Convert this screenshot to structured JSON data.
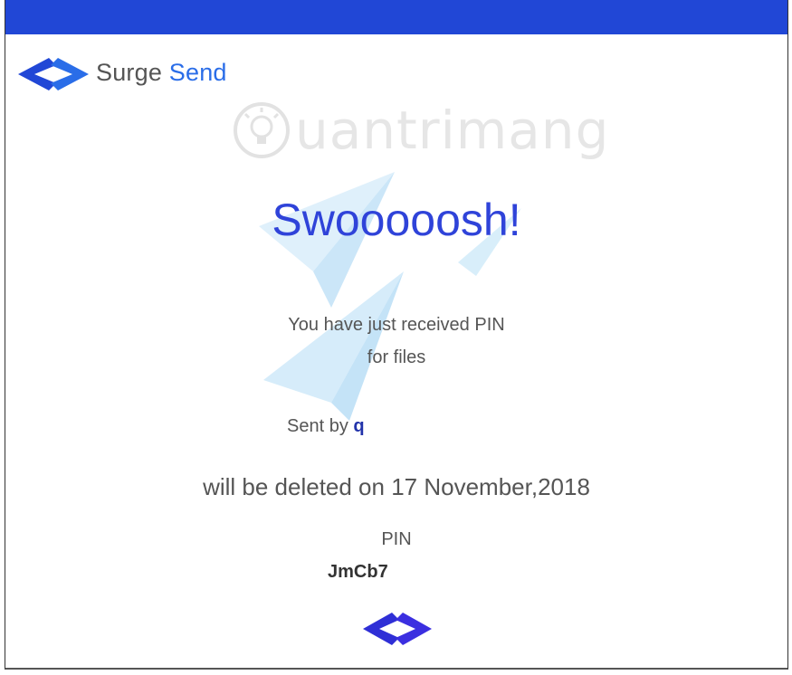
{
  "colors": {
    "topbar": "#2147d6",
    "brand_blue": "#2f43d9",
    "text_gray": "#555555"
  },
  "logo": {
    "word1": "Surge",
    "word2": "Send",
    "icon": "surge-send-arrows-icon"
  },
  "watermark": {
    "text": "uantrimang",
    "icon": "lightbulb-icon"
  },
  "headline": "Swooooosh!",
  "message": {
    "line1": "You have just received PIN",
    "line2": "for files"
  },
  "sent": {
    "label": "Sent by",
    "sender": "q"
  },
  "expiry": "will be deleted on 17 November,2018",
  "pin": {
    "label": "PIN",
    "value": "JmCb7"
  },
  "footer": {
    "icon": "surge-send-arrows-icon"
  }
}
